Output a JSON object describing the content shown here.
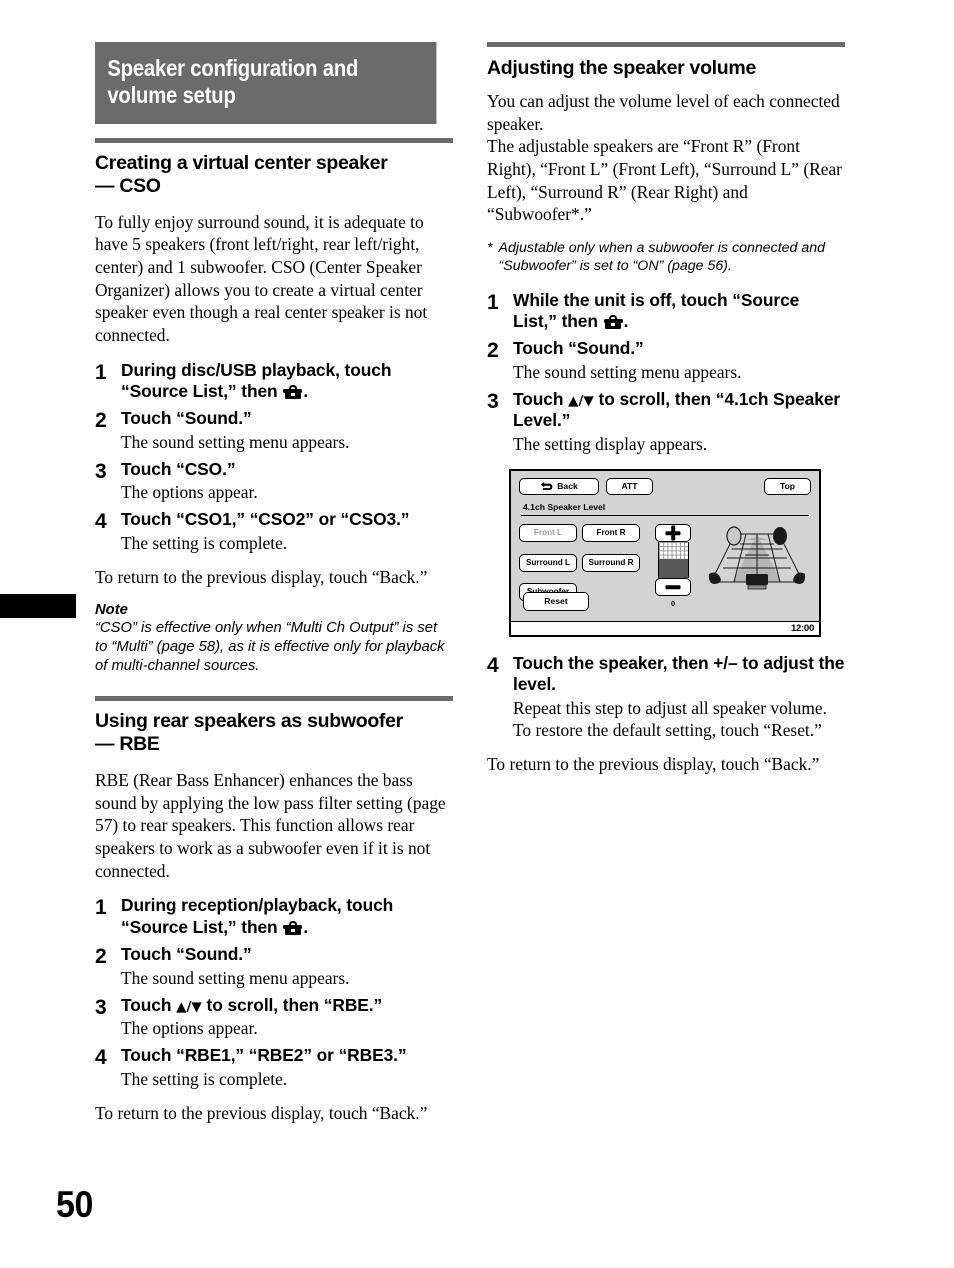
{
  "page": {
    "number": "50"
  },
  "banner": {
    "title_line1": "Speaker configuration and",
    "title_line2": "volume setup"
  },
  "left_column": {
    "section1": {
      "heading_line1": "Creating a virtual center speaker",
      "heading_line2": "— CSO",
      "intro": "To fully enjoy surround sound, it is adequate to have 5 speakers (front left/right, rear left/right, center) and 1 subwoofer. CSO (Center Speaker Organizer) allows you to create a virtual center speaker even though a real center speaker is not connected.",
      "steps": [
        {
          "num": "1",
          "title_pre": "During disc/USB playback, touch “Source List,” then ",
          "title_post": ".",
          "icon": "toolbox-icon",
          "desc": ""
        },
        {
          "num": "2",
          "title_pre": "Touch “Sound.”",
          "title_post": "",
          "desc": "The sound setting menu appears."
        },
        {
          "num": "3",
          "title_pre": "Touch “CSO.”",
          "title_post": "",
          "desc": "The options appear."
        },
        {
          "num": "4",
          "title_pre": "Touch “CSO1,” “CSO2” or “CSO3.”",
          "title_post": "",
          "desc": "The setting is complete."
        }
      ],
      "closing": "To return to the previous display, touch “Back.”",
      "note_heading": "Note",
      "note_body": "“CSO” is effective only when “Multi Ch Output” is set to “Multi” (page 58), as it is effective only for playback of multi-channel sources."
    },
    "section2": {
      "heading_line1": "Using rear speakers as subwoofer",
      "heading_line2": "— RBE",
      "intro": "RBE (Rear Bass Enhancer) enhances the bass sound by applying the low pass filter setting (page 57) to rear speakers. This function allows rear speakers to work as a subwoofer even if it is not connected.",
      "steps": [
        {
          "num": "1",
          "title_pre": "During reception/playback, touch “Source List,” then ",
          "title_post": ".",
          "icon": "toolbox-icon",
          "desc": ""
        },
        {
          "num": "2",
          "title_pre": "Touch “Sound.”",
          "title_post": "",
          "desc": "The sound setting menu appears."
        },
        {
          "num": "3",
          "title_pre": "Touch ",
          "title_mid": "▲/▼",
          "title_post": " to scroll, then “RBE.”",
          "desc": "The options appear."
        },
        {
          "num": "4",
          "title_pre": "Touch “RBE1,” “RBE2” or “RBE3.”",
          "title_post": "",
          "desc": "The setting is complete."
        }
      ],
      "closing": "To return to the previous display, touch “Back.”"
    }
  },
  "right_column": {
    "section": {
      "heading": "Adjusting the speaker volume",
      "intro": "You can adjust the volume level of each connected speaker.\nThe adjustable speakers are “Front R” (Front Right), “Front L” (Front Left), “Surround L” (Rear Left), “Surround R” (Rear Right) and “Subwoofer*.”",
      "footnote_mark": "*",
      "footnote_text": "Adjustable only when a subwoofer is connected and “Subwoofer” is set to “ON” (page 56).",
      "steps_before": [
        {
          "num": "1",
          "title_pre": "While the unit is off, touch “Source List,” then ",
          "title_post": ".",
          "icon": "toolbox-icon",
          "desc": ""
        },
        {
          "num": "2",
          "title_pre": "Touch “Sound.”",
          "title_post": "",
          "desc": "The sound setting menu appears."
        },
        {
          "num": "3",
          "title_pre": "Touch ",
          "title_mid": "▲/▼",
          "title_post": " to scroll, then “4.1ch Speaker Level.”",
          "desc": "The setting display appears."
        }
      ],
      "steps_after": [
        {
          "num": "4",
          "title_pre": "Touch the speaker, then +/– to adjust the level.",
          "title_post": "",
          "desc": "Repeat this step to adjust all speaker volume.\nTo restore the default setting, touch “Reset.”"
        }
      ],
      "closing": "To return to the previous display, touch “Back.”"
    },
    "screen": {
      "back_label": "Back",
      "back_icon": "back-arrow-icon",
      "att_label": "ATT",
      "top_label": "Top",
      "title": "4.1ch Speaker Level",
      "speaker_buttons": [
        {
          "label": "Front L",
          "state": "disabled"
        },
        {
          "label": "Front R",
          "state": "enabled"
        },
        {
          "label": "Surround L",
          "state": "enabled"
        },
        {
          "label": "Surround R",
          "state": "enabled"
        },
        {
          "label": "Subwoofer",
          "state": "enabled"
        }
      ],
      "level": {
        "plus_label": "+",
        "minus_label": "–",
        "value": "0"
      },
      "reset_label": "Reset",
      "clock": "12:00"
    }
  },
  "colors": {
    "banner_gray": "#6b6b6b",
    "rule_gray": "#6b6b6b",
    "screen_bg": "#d3d3d3",
    "level_fill": "#585858",
    "disabled_text": "#9a9a9a"
  }
}
